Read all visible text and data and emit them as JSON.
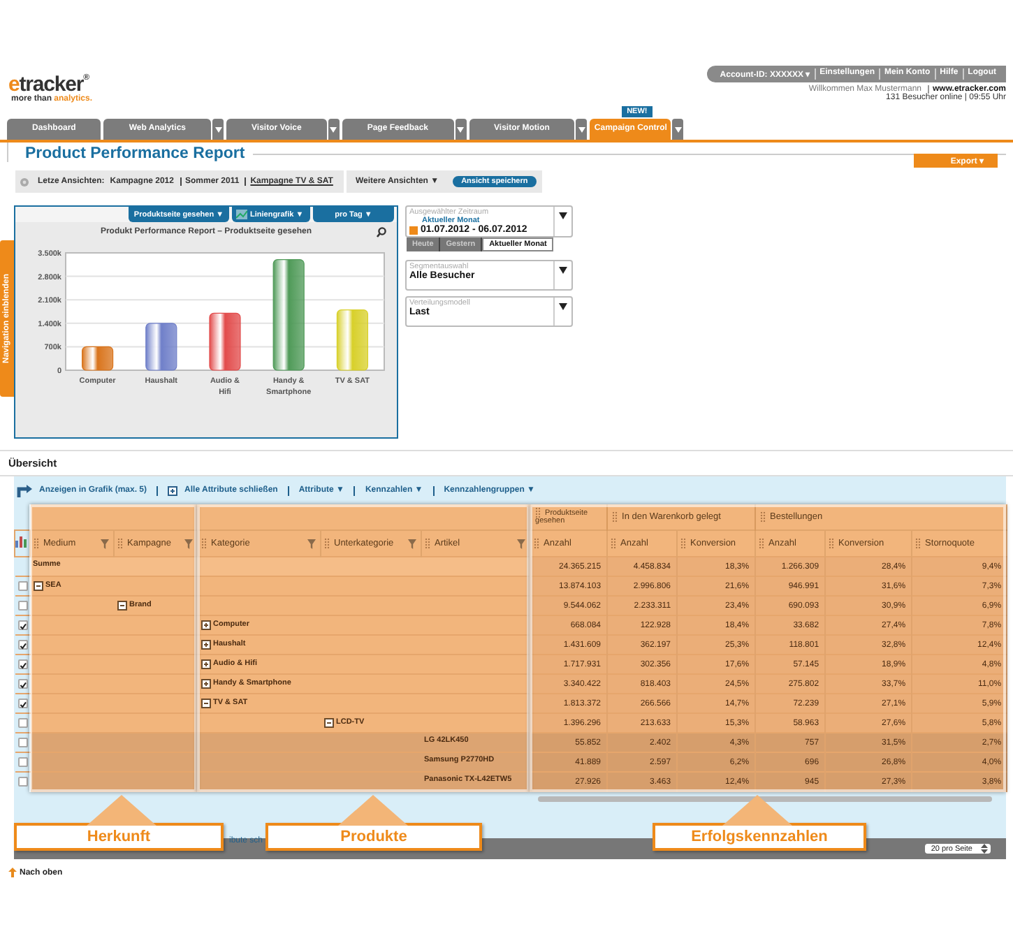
{
  "header": {
    "logo": {
      "mark": "e",
      "rest": "tracker",
      "registered": "®",
      "tagline_prefix": "more than",
      "tagline_highlight": "analytics."
    },
    "account_menu": [
      "Account-ID: XXXXXX ▾",
      "Einstellungen",
      "Mein Konto",
      "Hilfe",
      "Logout"
    ],
    "welcome": "Willkommen Max Mustermann",
    "site": "www.etracker.com",
    "status": "131 Besucher online | 09:55 Uhr"
  },
  "tabs": [
    {
      "label": "Dashboard",
      "selected": false,
      "menu": false
    },
    {
      "label": "Web Analytics",
      "selected": false,
      "menu": true
    },
    {
      "label": "Visitor Voice",
      "selected": false,
      "menu": true
    },
    {
      "label": "Page Feedback",
      "selected": false,
      "menu": true
    },
    {
      "label": "Visitor Motion",
      "selected": false,
      "menu": true
    },
    {
      "label": "Campaign Control",
      "selected": true,
      "menu": true,
      "badge": "NEW!"
    }
  ],
  "title": "Product Performance Report",
  "export_button": "Export ▾",
  "side_tab": "Navigation einblenden",
  "views_bar": {
    "label": "Letze Ansichten:",
    "views": [
      {
        "label": "Kampagne 2012",
        "current": false
      },
      {
        "label": "Sommer 2011",
        "current": false
      },
      {
        "label": "Kampagne TV & SAT",
        "current": true
      }
    ],
    "more": "Weitere Ansichten ▼",
    "save_button": "Ansicht speichern"
  },
  "chart_panel": {
    "controls": [
      "Produktseite gesehen ▼",
      "Liniengrafik ▼",
      "pro Tag ▼"
    ],
    "chart_data": {
      "type": "bar",
      "title": "Produkt Performance Report – Produktseite gesehen",
      "categories": [
        "Computer",
        "Haushalt",
        "Audio & Hifi",
        "Handy & Smartphone",
        "TV & SAT"
      ],
      "values": [
        700,
        1400,
        1700,
        3300,
        1800
      ],
      "grid": true,
      "colors": [
        "#d9741c",
        "#6f7fc9",
        "#e24b4b",
        "#4f9a58",
        "#d8d02a"
      ],
      "ylim": [
        0,
        3500
      ],
      "yticks": [
        {
          "value": 0,
          "label": "0"
        },
        {
          "value": 700,
          "label": "700k"
        },
        {
          "value": 1400,
          "label": "1.400k"
        },
        {
          "value": 2100,
          "label": "2.100k"
        },
        {
          "value": 2800,
          "label": "2.800k"
        },
        {
          "value": 3500,
          "label": "3.500k"
        }
      ]
    }
  },
  "date_filter": {
    "label": "Ausgewählter Zeitraum",
    "preset": "Aktueller Monat",
    "range": "01.07.2012 - 06.07.2012",
    "quick": [
      {
        "label": "Heute",
        "selected": false
      },
      {
        "label": "Gestern",
        "selected": false
      },
      {
        "label": "Aktueller Monat",
        "selected": true
      }
    ]
  },
  "segment_filter": {
    "label": "Segmentauswahl",
    "value": "Alle Besucher"
  },
  "model_filter": {
    "label": "Verteilungsmodell",
    "value": "Last"
  },
  "overview": {
    "title": "Übersicht",
    "show_in_chart": "Anzeigen in Grafik (max. 5)",
    "collapse_all": "Alle Attribute schließen",
    "menus": [
      "Attribute ▼",
      "Kennzahlen ▼",
      "Kennzahlengruppen ▼"
    ]
  },
  "table": {
    "attribute_columns": [
      "Medium",
      "Kampagne",
      "Kategorie",
      "Unterkategorie",
      "Artikel"
    ],
    "metric_groups": [
      {
        "label": "Produktseite gesehen",
        "columns": [
          "Anzahl"
        ]
      },
      {
        "label": "In den Warenkorb gelegt",
        "columns": [
          "Anzahl",
          "Konversion"
        ]
      },
      {
        "label": "Bestellungen",
        "columns": [
          "Anzahl",
          "Konversion",
          "Stornoquote"
        ]
      }
    ],
    "rows": [
      {
        "label": "Summe",
        "kind": "total",
        "values": [
          "24.365.215",
          "4.458.834",
          "18,3%",
          "1.266.309",
          "28,4%",
          "9,4%"
        ]
      },
      {
        "label": "SEA",
        "checked": false,
        "expanded": true,
        "values": [
          "13.874.103",
          "2.996.806",
          "21,6%",
          "946.991",
          "31,6%",
          "7,3%"
        ],
        "children": [
          {
            "label": "Brand",
            "checked": false,
            "expanded": true,
            "values": [
              "9.544.062",
              "2.233.311",
              "23,4%",
              "690.093",
              "30,9%",
              "6,9%"
            ],
            "children": [
              {
                "label": "Computer",
                "checked": true,
                "expanded": false,
                "values": [
                  "668.084",
                  "122.928",
                  "18,4%",
                  "33.682",
                  "27,4%",
                  "7,8%"
                ]
              },
              {
                "label": "Haushalt",
                "checked": true,
                "expanded": false,
                "values": [
                  "1.431.609",
                  "362.197",
                  "25,3%",
                  "118.801",
                  "32,8%",
                  "12,4%"
                ]
              },
              {
                "label": "Audio & Hifi",
                "checked": true,
                "expanded": false,
                "values": [
                  "1.717.931",
                  "302.356",
                  "17,6%",
                  "57.145",
                  "18,9%",
                  "4,8%"
                ]
              },
              {
                "label": "Handy & Smartphone",
                "checked": true,
                "expanded": false,
                "values": [
                  "3.340.422",
                  "818.403",
                  "24,5%",
                  "275.802",
                  "33,7%",
                  "11,0%"
                ]
              },
              {
                "label": "TV & SAT",
                "checked": true,
                "expanded": true,
                "values": [
                  "1.813.372",
                  "266.566",
                  "14,7%",
                  "72.239",
                  "27,1%",
                  "5,9%"
                ],
                "children": [
                  {
                    "label": "LCD-TV",
                    "checked": false,
                    "expanded": true,
                    "values": [
                      "1.396.296",
                      "213.633",
                      "15,3%",
                      "58.963",
                      "27,6%",
                      "5,8%"
                    ],
                    "children": [
                      {
                        "label": "LG 42LK450",
                        "checked": false,
                        "values": [
                          "55.852",
                          "2.402",
                          "4,3%",
                          "757",
                          "31,5%",
                          "2,7%"
                        ]
                      },
                      {
                        "label": "Samsung P2770HD",
                        "checked": false,
                        "values": [
                          "41.889",
                          "2.597",
                          "6,2%",
                          "696",
                          "26,8%",
                          "4,0%"
                        ]
                      },
                      {
                        "label": "Panasonic TX-L42ETW5",
                        "checked": false,
                        "values": [
                          "27.926",
                          "3.463",
                          "12,4%",
                          "945",
                          "27,3%",
                          "3,8%"
                        ]
                      }
                    ]
                  }
                ]
              }
            ]
          }
        ]
      }
    ]
  },
  "callouts": [
    "Herkunft",
    "Produkte",
    "Erfolgskennzahlen"
  ],
  "footer": {
    "fragment": "ibute sch",
    "page_size": "20 pro Seite",
    "back_to_top": "Nach oben"
  }
}
